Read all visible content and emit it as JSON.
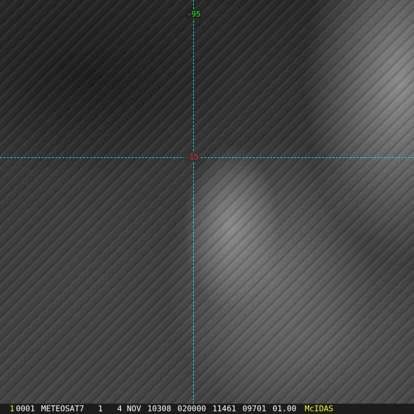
{
  "image": {
    "kind": "satellite-infrared",
    "grid_color": "#00e5e5"
  },
  "grid_labels": {
    "latitude_top": "-95",
    "longitude": "-15"
  },
  "status_bar": {
    "frame_number": "1",
    "fields": [
      "0001",
      "METEOSAT7",
      "1",
      "4 NOV",
      "10308",
      "020000",
      "11461",
      "09701",
      "01.00"
    ],
    "brand": "McIDAS"
  }
}
